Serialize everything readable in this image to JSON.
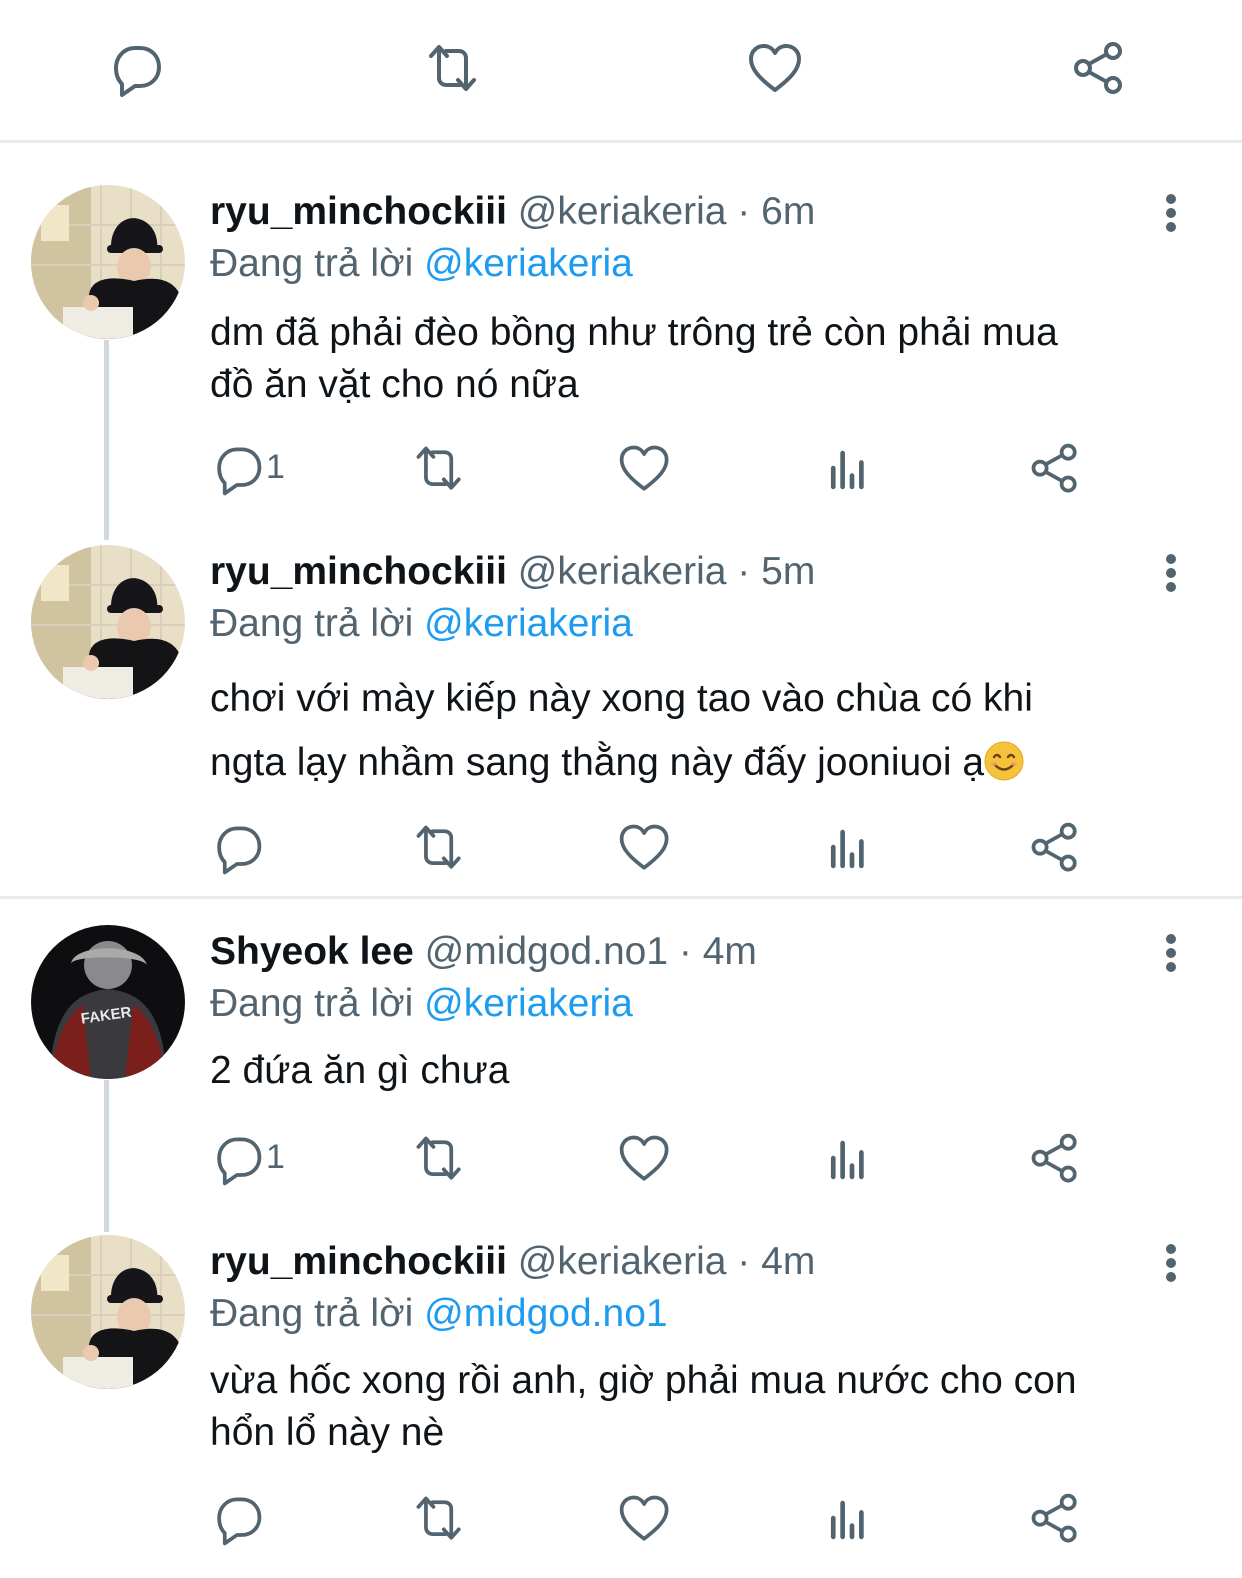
{
  "top_actions": {
    "reply_icon": "reply-icon",
    "retweet_icon": "retweet-icon",
    "like_icon": "heart-icon",
    "share_icon": "share-icon"
  },
  "reply_prefix": "Đang trả lời",
  "tweets": [
    {
      "name": "ryu_minchockiii",
      "handle": "@keriakeria",
      "time": "6m",
      "replying_to": "@keriakeria",
      "lines": [
        "dm đã phải đèo bồng như trông trẻ còn phải mua",
        "đồ ăn vặt cho nó nữa"
      ],
      "reply_count": "1"
    },
    {
      "name": "ryu_minchockiii",
      "handle": "@keriakeria",
      "time": "5m",
      "replying_to": "@keriakeria",
      "lines": [
        "chơi với mày kiếp này xong tao vào chùa có khi",
        "ngta lạy nhầm sang thằng này đấy jooniuoi ạ"
      ],
      "emoji": "smiling-face-emoji",
      "reply_count": ""
    },
    {
      "name": "Shyeok lee",
      "handle": "@midgod.no1",
      "time": "4m",
      "replying_to": "@keriakeria",
      "lines": [
        "2 đứa ăn gì chưa"
      ],
      "avatar_text": "FAKER",
      "reply_count": "1"
    },
    {
      "name": "ryu_minchockiii",
      "handle": "@keriakeria",
      "time": "4m",
      "replying_to": "@midgod.no1",
      "lines": [
        "vừa hốc xong rồi anh, giờ phải mua nước cho con",
        "hổn lổ này nè"
      ],
      "reply_count": ""
    }
  ],
  "colors": {
    "text": "#0f1419",
    "secondary": "#536471",
    "link": "#1d9bf0",
    "divider": "#e6ecf0"
  }
}
